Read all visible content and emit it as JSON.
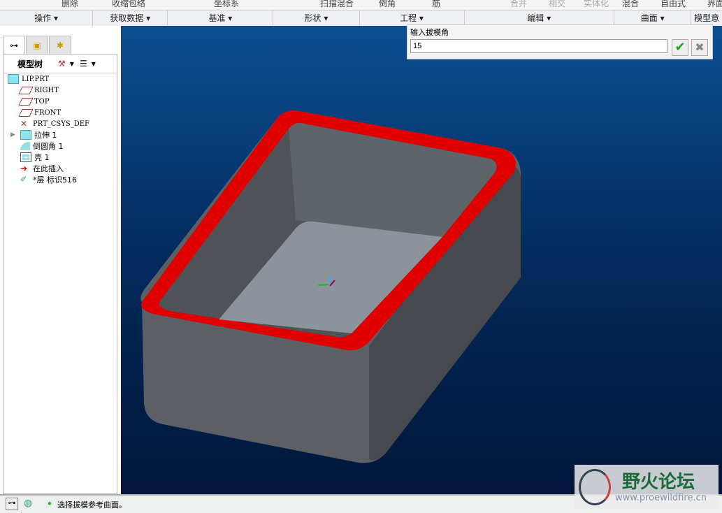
{
  "ribbon_top": [
    "删除",
    "收缩包络",
    "坐标系",
    "扫描混合",
    "倒角",
    "筋",
    "合并",
    "相交",
    "实体化",
    "混合",
    "自由式",
    "界面"
  ],
  "groups": [
    "操作",
    "获取数据",
    "基准",
    "形状",
    "工程",
    "编辑",
    "曲面",
    "模型意"
  ],
  "model_tree": {
    "title": "模型树",
    "items": [
      {
        "label": "LIP.PRT",
        "icon": "part-icon"
      },
      {
        "label": "RIGHT",
        "icon": "datum-plane-icon"
      },
      {
        "label": "TOP",
        "icon": "datum-plane-icon"
      },
      {
        "label": "FRONT",
        "icon": "datum-plane-icon"
      },
      {
        "label": "PRT_CSYS_DEF",
        "icon": "csys-icon"
      },
      {
        "label": "拉伸 1",
        "icon": "extrude-icon"
      },
      {
        "label": "倒圆角 1",
        "icon": "round-icon"
      },
      {
        "label": "壳 1",
        "icon": "shell-icon"
      },
      {
        "label": "在此插入",
        "icon": "insert-arrow-icon"
      },
      {
        "label": "*层 标识516",
        "icon": "draft-icon"
      }
    ]
  },
  "dashboard": {
    "label": "输入拔模角",
    "value": "15"
  },
  "status": {
    "message": "选择拔模参考曲面。"
  },
  "watermark": {
    "title": "野火论坛",
    "url": "www.proewildfire.cn"
  },
  "colors": {
    "rim": "#e00000",
    "wall": "#5c6064"
  }
}
